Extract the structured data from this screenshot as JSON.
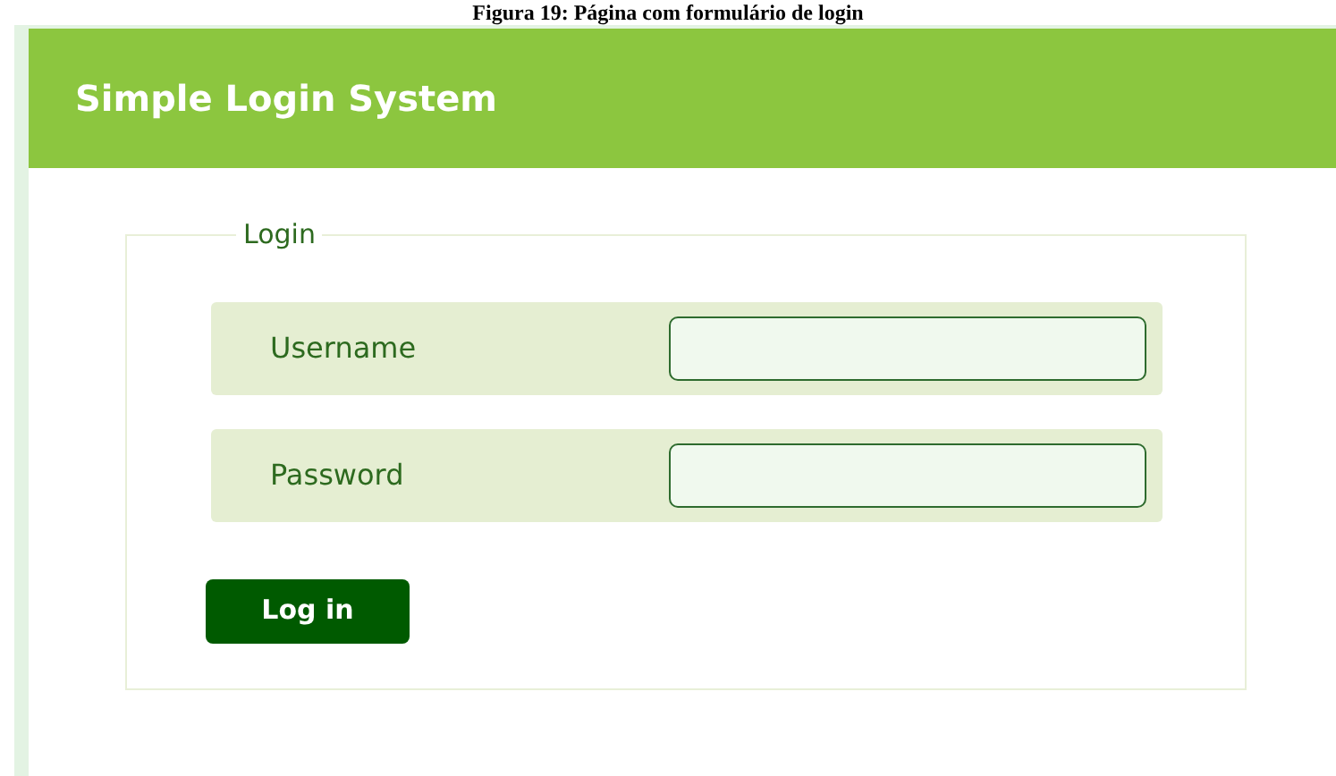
{
  "caption": "Figura 19: Página com formulário de login",
  "header": {
    "title": "Simple Login System"
  },
  "form": {
    "legend": "Login",
    "fields": [
      {
        "label": "Username"
      },
      {
        "label": "Password"
      }
    ],
    "submit": "Log in"
  }
}
